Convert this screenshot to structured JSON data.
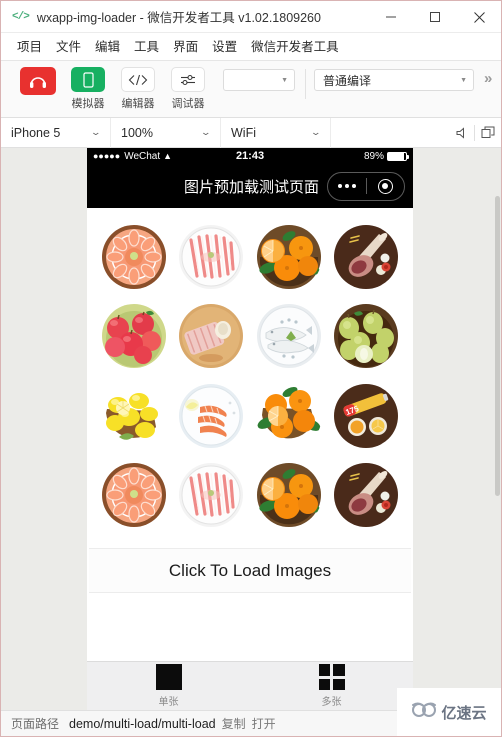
{
  "window": {
    "logo_icon": "code-brackets-icon",
    "title": "wxapp-img-loader - 微信开发者工具 v1.02.1809260",
    "minimize_label": "—",
    "maximize_label": "□",
    "close_label": "✕"
  },
  "menubar": {
    "items": [
      {
        "label": "项目"
      },
      {
        "label": "文件"
      },
      {
        "label": "编辑"
      },
      {
        "label": "工具"
      },
      {
        "label": "界面"
      },
      {
        "label": "设置"
      },
      {
        "label": "微信开发者工具"
      }
    ]
  },
  "toolbar": {
    "account_icon": "user-avatar-icon",
    "buttons": [
      {
        "label": "模拟器",
        "icon": "simulator-icon"
      },
      {
        "label": "编辑器",
        "icon": "code-editor-icon"
      },
      {
        "label": "调试器",
        "icon": "debugger-icon"
      }
    ],
    "blank_select_value": "",
    "compile_select_value": "普通编译",
    "more_label": "»"
  },
  "devicebar": {
    "device": "iPhone 5",
    "zoom": "100%",
    "network": "WiFi",
    "mute_icon": "speaker-mute-icon",
    "window_icon": "detach-window-icon"
  },
  "simulator": {
    "status": {
      "signal_dots": "●●●●●",
      "carrier": "WeChat",
      "wifi_icon": "wifi-icon",
      "time": "21:43",
      "battery_percent": "89%",
      "battery_level": 89
    },
    "nav": {
      "title": "图片预加载测试页面",
      "menu_icon": "more-dots-icon",
      "close_icon": "target-circle-icon"
    },
    "grid": {
      "images": [
        {
          "alt": "salmon-sashimi-platter",
          "kind": "salmon"
        },
        {
          "alt": "sliced-pork-belly",
          "kind": "pork"
        },
        {
          "alt": "oranges-basket",
          "kind": "orange"
        },
        {
          "alt": "lamb-leg-board",
          "kind": "lamb"
        },
        {
          "alt": "red-apples-bowl",
          "kind": "apple"
        },
        {
          "alt": "raw-fish-fillet-board",
          "kind": "fillet"
        },
        {
          "alt": "white-fish-plate",
          "kind": "fish"
        },
        {
          "alt": "green-pears-bowl",
          "kind": "pear"
        },
        {
          "alt": "lemons-bowl",
          "kind": "lemon"
        },
        {
          "alt": "shrimp-plate",
          "kind": "shrimp"
        },
        {
          "alt": "oranges-halved-bowl",
          "kind": "orange2"
        },
        {
          "alt": "juice-bottle-board",
          "kind": "juice"
        },
        {
          "alt": "salmon-sashimi-platter",
          "kind": "salmon"
        },
        {
          "alt": "sliced-pork-belly",
          "kind": "pork"
        },
        {
          "alt": "oranges-basket",
          "kind": "orange"
        },
        {
          "alt": "lamb-leg-board",
          "kind": "lamb"
        }
      ]
    },
    "load_button_label": "Click To Load Images",
    "tabbar": {
      "tabs": [
        {
          "label": "单张",
          "icon": "single-square-icon"
        },
        {
          "label": "多张",
          "icon": "multi-grid-icon"
        }
      ]
    }
  },
  "statusbar": {
    "path_label": "页面路径",
    "path_value": "demo/multi-load/multi-load",
    "copy_label": "复制",
    "open_label": "打开"
  },
  "watermark": {
    "logo_icon": "cloud-logo-icon",
    "text": "亿速云"
  },
  "colors": {
    "accent_red": "#e8312f",
    "accent_green": "#17b061",
    "window_border": "#d9b3b3",
    "canvas_bg": "#ebebe8"
  }
}
